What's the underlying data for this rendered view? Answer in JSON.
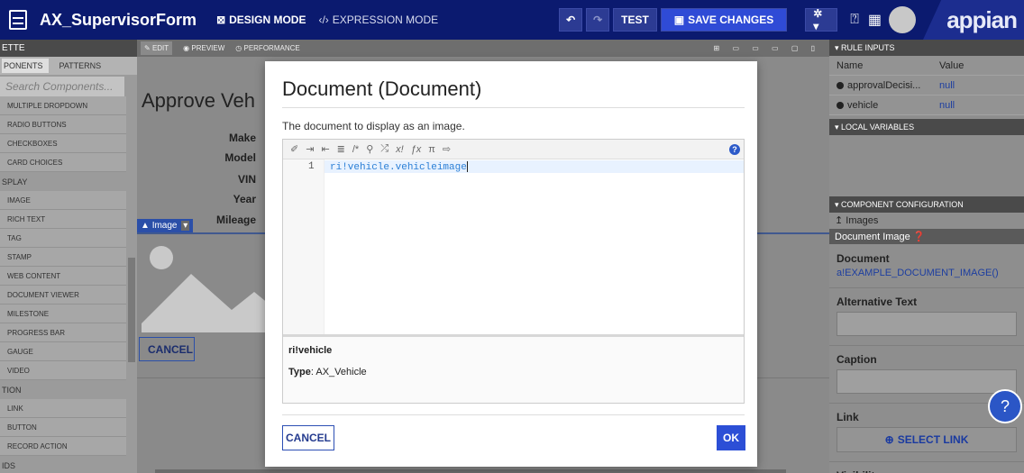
{
  "topbar": {
    "app_title": "AX_SupervisorForm",
    "design_mode": "DESIGN MODE",
    "expression_mode": "EXPRESSION MODE",
    "test_label": "TEST",
    "save_label": "SAVE CHANGES",
    "logo_text": "appian"
  },
  "palette": {
    "header": "ETTE",
    "tabs": [
      "PONENTS",
      "PATTERNS"
    ],
    "search_placeholder": "Search Components...",
    "items": [
      {
        "kind": "item",
        "label": "MULTIPLE DROPDOWN"
      },
      {
        "kind": "item",
        "label": "RADIO BUTTONS"
      },
      {
        "kind": "item",
        "label": "CHECKBOXES"
      },
      {
        "kind": "item",
        "label": "CARD CHOICES"
      },
      {
        "kind": "section",
        "label": "SPLAY"
      },
      {
        "kind": "item",
        "label": "IMAGE"
      },
      {
        "kind": "item",
        "label": "RICH TEXT"
      },
      {
        "kind": "item",
        "label": "TAG"
      },
      {
        "kind": "item",
        "label": "STAMP"
      },
      {
        "kind": "item",
        "label": "WEB CONTENT"
      },
      {
        "kind": "item",
        "label": "DOCUMENT VIEWER"
      },
      {
        "kind": "item",
        "label": "MILESTONE"
      },
      {
        "kind": "item",
        "label": "PROGRESS BAR"
      },
      {
        "kind": "item",
        "label": "GAUGE"
      },
      {
        "kind": "item",
        "label": "VIDEO"
      },
      {
        "kind": "section",
        "label": "TION"
      },
      {
        "kind": "item",
        "label": "LINK"
      },
      {
        "kind": "item",
        "label": "BUTTON"
      },
      {
        "kind": "item",
        "label": "RECORD ACTION"
      },
      {
        "kind": "section",
        "label": "IDS"
      }
    ]
  },
  "editor": {
    "tabs": [
      "EDIT",
      "PREVIEW",
      "PERFORMANCE"
    ],
    "heading": "Approve Veh",
    "fields": [
      "Make",
      "Model",
      "VIN",
      "Year",
      "Mileage"
    ],
    "image_tag": "Image",
    "cancel_label": "CANCEL"
  },
  "right_pane": {
    "rule_inputs_header": "RULE INPUTS",
    "col_name": "Name",
    "col_value": "Value",
    "rule_inputs": [
      {
        "name": "approvalDecisi...",
        "value": "null"
      },
      {
        "name": "vehicle",
        "value": "null"
      }
    ],
    "local_vars_header": "LOCAL VARIABLES",
    "component_config_header": "COMPONENT CONFIGURATION",
    "breadcrumb": "Images",
    "sub_header": "Document Image",
    "document_label": "Document",
    "document_value": "a!EXAMPLE_DOCUMENT_IMAGE()",
    "alt_text_label": "Alternative Text",
    "caption_label": "Caption",
    "link_label": "Link",
    "select_link_label": "SELECT LINK",
    "visibility_label": "Visibility"
  },
  "modal": {
    "title": "Document (Document)",
    "description": "The document to display as an image.",
    "line_number": "1",
    "code": "ri!vehicle.vehicleimage",
    "info_name": "ri!vehicle",
    "info_type_label": "Type",
    "info_type_value": ": AX_Vehicle",
    "cancel_label": "CANCEL",
    "ok_label": "OK"
  }
}
